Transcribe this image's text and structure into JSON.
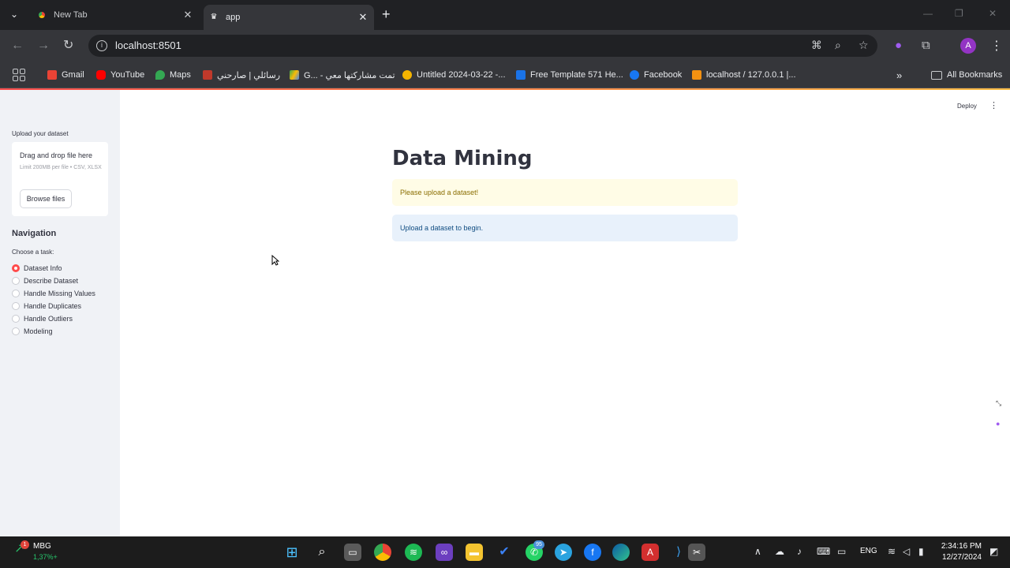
{
  "browser": {
    "tabs": [
      {
        "title": "New Tab",
        "active": false
      },
      {
        "title": "app",
        "active": true
      }
    ],
    "url": "localhost:8501",
    "profile_initial": "A",
    "bookmarks": [
      {
        "label": "Gmail",
        "color": "#ea4335"
      },
      {
        "label": "YouTube",
        "color": "#ff0000"
      },
      {
        "label": "Maps",
        "color": "#34a853"
      },
      {
        "label": "رسائلي | صارحني",
        "color": "#c0392b"
      },
      {
        "label": "G... - تمت مشاركتها معي",
        "color": "#fbbc04"
      },
      {
        "label": "Untitled 2024-03-22 -...",
        "color": "#f4b400"
      },
      {
        "label": "Free Template 571 He...",
        "color": "#1a73e8"
      },
      {
        "label": "Facebook",
        "color": "#1877f2"
      },
      {
        "label": "localhost / 127.0.0.1 |...",
        "color": "#f29111"
      }
    ],
    "all_bookmarks": "All Bookmarks"
  },
  "app": {
    "deploy_label": "Deploy",
    "sidebar": {
      "upload_label": "Upload your dataset",
      "dropzone_title": "Drag and drop file here",
      "dropzone_limit": "Limit 200MB per file • CSV, XLSX",
      "browse_label": "Browse files",
      "nav_title": "Navigation",
      "choose_label": "Choose a task:",
      "tasks": [
        {
          "label": "Dataset Info",
          "selected": true
        },
        {
          "label": "Describe Dataset",
          "selected": false
        },
        {
          "label": "Handle Missing Values",
          "selected": false
        },
        {
          "label": "Handle Duplicates",
          "selected": false
        },
        {
          "label": "Handle Outliers",
          "selected": false
        },
        {
          "label": "Modeling",
          "selected": false
        }
      ]
    },
    "main": {
      "title": "Data Mining",
      "warning": "Please upload a dataset!",
      "info": "Upload a dataset to begin."
    },
    "accent_color": "#ff4b4b"
  },
  "taskbar": {
    "stock_badge": "1",
    "stock_name": "MBG",
    "stock_value": "1,37%+",
    "telegram_badge": "95",
    "language": "ENG",
    "time": "2:34:16 PM",
    "date": "12/27/2024"
  }
}
